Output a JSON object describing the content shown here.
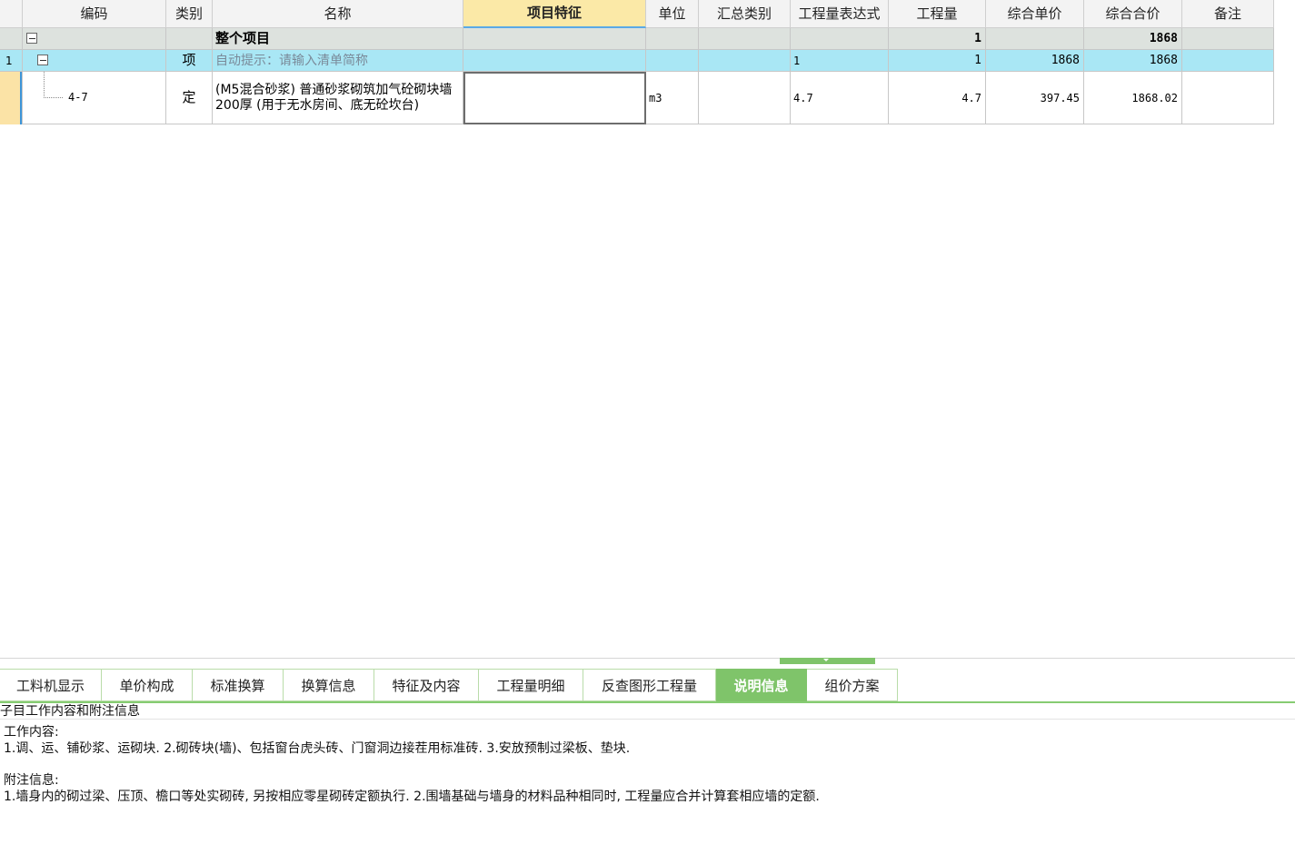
{
  "header": {
    "code": "编码",
    "type": "类别",
    "name": "名称",
    "feature": "项目特征",
    "unit": "单位",
    "summary_type": "汇总类别",
    "qty_expr": "工程量表达式",
    "qty": "工程量",
    "unit_price": "综合单价",
    "total_price": "综合合价",
    "remark": "备注"
  },
  "rows": [
    {
      "index": "",
      "code": "",
      "type": "",
      "name": "整个项目",
      "feature": "",
      "unit": "",
      "summary_type": "",
      "qty_expr": "",
      "qty": "1",
      "unit_price": "",
      "total_price": "1868",
      "remark": ""
    },
    {
      "index": "1",
      "code": "",
      "type": "项",
      "name": "自动提示：请输入清单简称",
      "feature": "",
      "unit": "",
      "summary_type": "",
      "qty_expr": "1",
      "qty": "1",
      "unit_price": "1868",
      "total_price": "1868",
      "remark": ""
    },
    {
      "index": "",
      "code": "4-7",
      "type": "定",
      "name": "(M5混合砂浆) 普通砂浆砌筑加气砼砌块墙 200厚 (用于无水房间、底无砼坎台)",
      "feature": "",
      "unit": "m3",
      "summary_type": "",
      "qty_expr": "4.7",
      "qty": "4.7",
      "unit_price": "397.45",
      "total_price": "1868.02",
      "remark": ""
    }
  ],
  "tabs": [
    {
      "label": "工料机显示"
    },
    {
      "label": "单价构成"
    },
    {
      "label": "标准换算"
    },
    {
      "label": "换算信息"
    },
    {
      "label": "特征及内容"
    },
    {
      "label": "工程量明细"
    },
    {
      "label": "反查图形工程量"
    },
    {
      "label": "说明信息",
      "selected": true
    },
    {
      "label": "组价方案"
    }
  ],
  "info": {
    "section_title": "子目工作内容和附注信息",
    "work_title": "工作内容:",
    "work_text": "1.调、运、铺砂浆、运砌块. 2.砌砖块(墙)、包括窗台虎头砖、门窗洞边接茬用标准砖. 3.安放预制过梁板、垫块.",
    "note_title": "附注信息:",
    "note_text": "1.墙身内的砌过梁、压顶、檐口等处实砌砖, 另按相应零星砌砖定额执行. 2.围墙基础与墙身的材料品种相同时, 工程量应合并计算套相应墙的定额."
  },
  "colors": {
    "header_bg": "#f3f3f3",
    "active_header_bg": "#fbe9a7",
    "root_row_bg": "#dde2de",
    "item_row_bg": "#a9e7f5",
    "tab_selected_bg": "#7fc46a"
  }
}
